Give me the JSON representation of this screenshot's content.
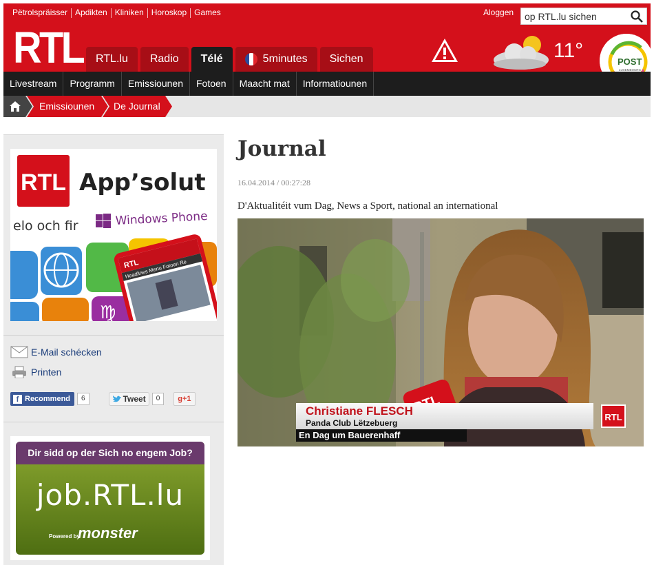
{
  "header": {
    "top_links": [
      "Pëtrolspräisser",
      "Apdikten",
      "Kliniken",
      "Horoskop",
      "Games"
    ],
    "login": "Aloggen",
    "search_placeholder": "op RTL.lu sichen",
    "logo": "RTL",
    "tabs": [
      {
        "label": "RTL.lu",
        "active": false
      },
      {
        "label": "Radio",
        "active": false
      },
      {
        "label": "Télé",
        "active": true
      },
      {
        "label": "5minutes",
        "active": false,
        "icon": "france-flag-icon"
      },
      {
        "label": "Sichen",
        "active": false
      }
    ],
    "temperature": "11°",
    "colors": {
      "brand_red": "#d4101b",
      "tab_dark_red": "#a70e16",
      "nav_dark": "#1d1d1d"
    }
  },
  "subnav": [
    "Livestream",
    "Programm",
    "Emissiounen",
    "Fotoen",
    "Maacht mat",
    "Informatiounen"
  ],
  "breadcrumb": {
    "items": [
      "Emissiounen",
      "De Journal"
    ]
  },
  "sidebar": {
    "ad1": {
      "brand": "RTL",
      "title": "App’solut",
      "subtitle": "elo och fir",
      "platform": "Windows Phone",
      "phone_tabs": "Headlines  Menu  Fotoen  Re"
    },
    "email_label": "E-Mail schécken",
    "print_label": "Printen",
    "facebook_label": "Recommend",
    "facebook_count": "6",
    "tweet_label": "Tweet",
    "tweet_count": "0",
    "gplus_label": "g+1",
    "ad2": {
      "question": "Dir sidd op der Sich no engem Job?",
      "site": "job.RTL.lu",
      "powered": "Powered by",
      "brand": "monster"
    }
  },
  "main": {
    "title": "Journal",
    "date": "16.04.2014 / 00:27:28",
    "description": "D'Aktualitéit vum Dag, News a Sport, national an international",
    "video": {
      "person_name": "Christiane FLESCH",
      "person_org": "Panda Club Lëtzebuerg",
      "caption": "En Dag um Bauerenhaff",
      "bug": "RTL"
    }
  }
}
